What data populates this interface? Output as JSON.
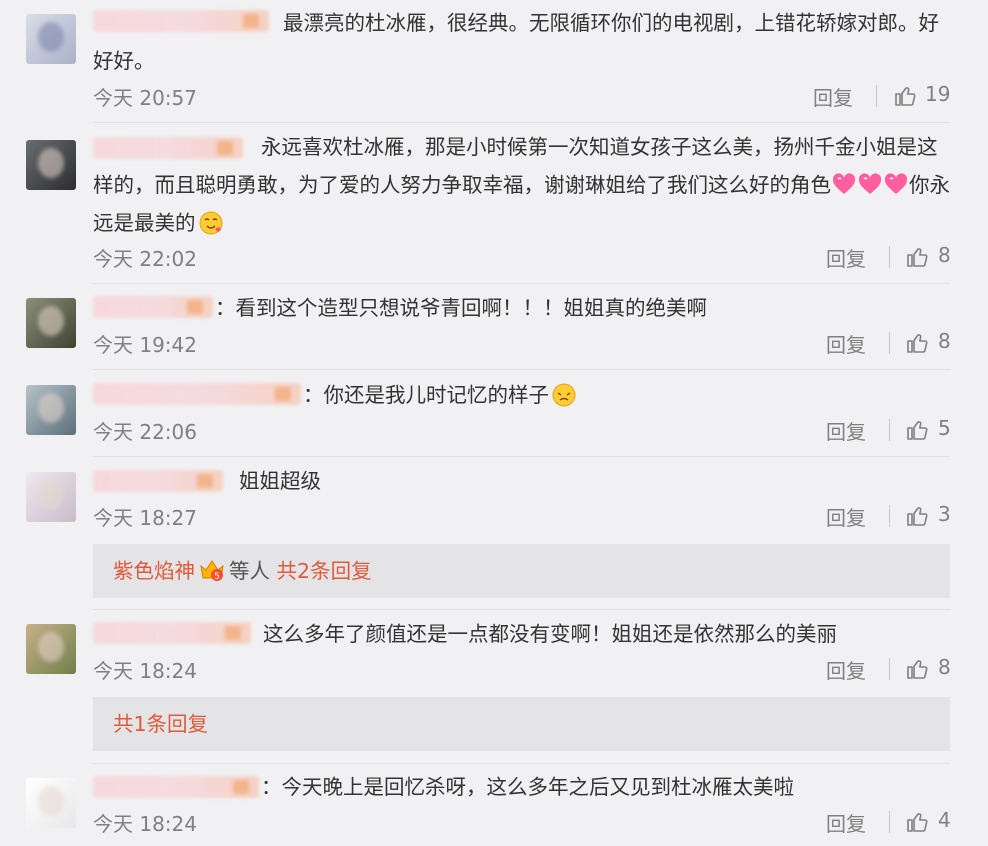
{
  "comments": [
    {
      "text": "最漂亮的杜冰雁，很经典。无限循环你们的电视剧，上错花轿嫁对郎。好好好。",
      "time": "今天 20:57",
      "reply_label": "回复",
      "likes": "19"
    },
    {
      "text": "永远喜欢杜冰雁，那是小时候第一次知道女孩子这么美，扬州千金小姐是这样的，而且聪明勇敢，为了爱的人努力争取幸福，谢谢琳姐给了我们这么好的角色",
      "text_tail": "你永远是最美的",
      "time": "今天 22:02",
      "reply_label": "回复",
      "likes": "8"
    },
    {
      "text": "：看到这个造型只想说爷青回啊！！！姐姐真的绝美啊",
      "time": "今天 19:42",
      "reply_label": "回复",
      "likes": "8"
    },
    {
      "text": "：你还是我儿时记忆的样子",
      "time": "今天 22:06",
      "reply_label": "回复",
      "likes": "5"
    },
    {
      "text": "姐姐超级",
      "time": "今天 18:27",
      "reply_label": "回复",
      "likes": "3",
      "sub_replies": {
        "user": "紫色焰神",
        "middle": "等人",
        "count_text": "共2条回复"
      }
    },
    {
      "text": "这么多年了颜值还是一点都没有变啊！姐姐还是依然那么的美丽",
      "time": "今天 18:24",
      "reply_label": "回复",
      "likes": "8",
      "sub_replies": {
        "count_text": "共1条回复"
      }
    },
    {
      "text": "：今天晚上是回忆杀呀，这么多年之后又见到杜冰雁太美啦",
      "time": "今天 18:24",
      "reply_label": "回复",
      "likes": "4"
    }
  ],
  "colors": {
    "accent_link": "#e05a3a",
    "meta_text": "#808080",
    "background": "#f1f1f3"
  },
  "icons": {
    "like": "thumbs-up-icon",
    "heart_emoji": "heart-emoji-icon",
    "face_emoji": "face-emoji-icon",
    "badge": "vip-badge-icon"
  }
}
